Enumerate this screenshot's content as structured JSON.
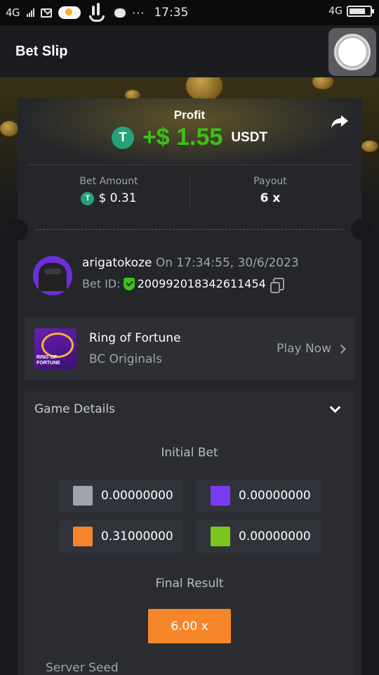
{
  "status_bar": {
    "network_left": "4G",
    "time": "17:35",
    "network_right": "4G",
    "more_dots": "···"
  },
  "header": {
    "title": "Bet Slip"
  },
  "profit": {
    "label": "Profit",
    "value": "+$ 1.55",
    "currency": "USDT",
    "token_symbol": "T",
    "value_color": "#3bc117"
  },
  "stats": {
    "bet_amount_label": "Bet Amount",
    "bet_amount_value": "$ 0.31",
    "payout_label": "Payout",
    "payout_value": "6 x"
  },
  "user": {
    "username": "arigatokoze",
    "timestamp": "On 17:34:55, 30/6/2023",
    "bet_id_label": "Bet ID:",
    "bet_id": "200992018342611454"
  },
  "game": {
    "name": "Ring of Fortune",
    "category": "BC Originals",
    "play_label": "Play Now",
    "thumb_text": "RING OF\nFORTUNE"
  },
  "details": {
    "header": "Game Details",
    "initial_bet_title": "Initial Bet",
    "bets": [
      {
        "color": "#9ea3ad",
        "value": "0.00000000"
      },
      {
        "color": "#7a3cf2",
        "value": "0.00000000"
      },
      {
        "color": "#f6862a",
        "value": "0.31000000"
      },
      {
        "color": "#7cc51d",
        "value": "0.00000000"
      }
    ],
    "final_result_title": "Final Result",
    "final_result_value": "6.00 x",
    "final_result_color": "#f6862a",
    "server_seed_label": "Server Seed"
  },
  "icons": [
    "signal-icon",
    "mail-icon",
    "cloud-icon",
    "hand-icon",
    "chat-icon",
    "battery-icon",
    "share-icon",
    "tether-icon",
    "shield-check-icon",
    "copy-icon",
    "chevron-right-icon",
    "chevron-down-icon"
  ]
}
